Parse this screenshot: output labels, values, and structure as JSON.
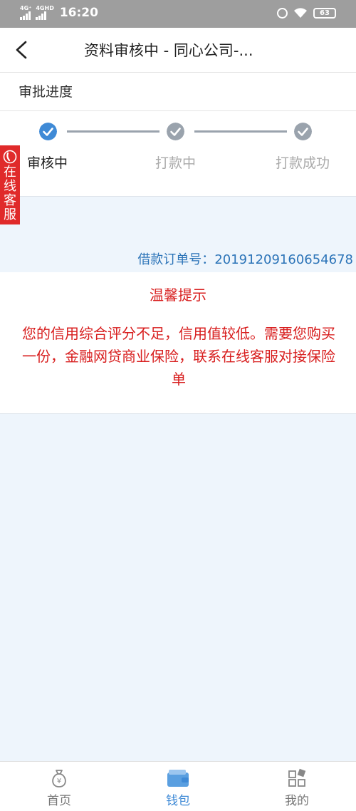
{
  "status_bar": {
    "signal1_label": "4G⁺",
    "signal2_label": "4GHD",
    "time": "16:20",
    "battery": "63"
  },
  "nav": {
    "title": "资料审核中 - 同心公司-..."
  },
  "section": {
    "title": "审批进度"
  },
  "progress": {
    "steps": [
      {
        "label": "审核中",
        "state": "done"
      },
      {
        "label": "打款中",
        "state": "pending"
      },
      {
        "label": "打款成功",
        "state": "pending"
      }
    ]
  },
  "customer_service": {
    "label_chars": [
      "在",
      "线",
      "客",
      "服"
    ]
  },
  "order": {
    "label": "借款订单号：",
    "number": "20191209160654678"
  },
  "notice": {
    "title": "温馨提示",
    "lines": [
      "您的信用综合评分不足，信用值较低。需要您购买",
      "一份，金融网贷商业保险，联系在线客服对接保险",
      "单"
    ]
  },
  "tabbar": {
    "items": [
      {
        "label": "首页",
        "icon": "money-bag-icon",
        "active": false
      },
      {
        "label": "钱包",
        "icon": "wallet-icon",
        "active": true
      },
      {
        "label": "我的",
        "icon": "grid-icon",
        "active": false
      }
    ]
  },
  "colors": {
    "accent": "#3f8ad6",
    "alert": "#d81e1e",
    "cs_tab": "#e02a2a"
  }
}
